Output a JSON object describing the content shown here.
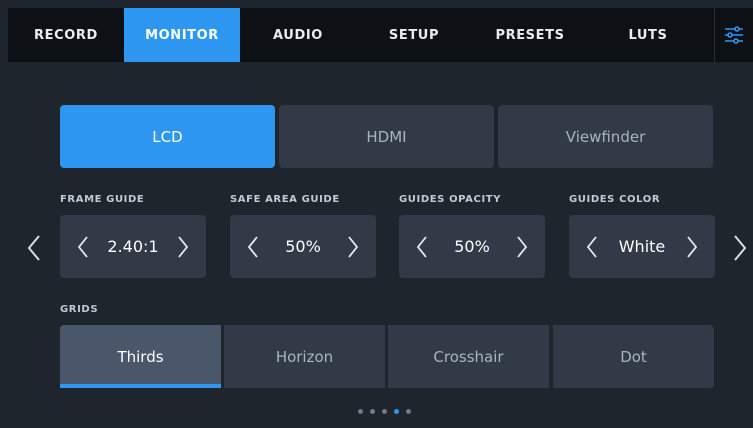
{
  "tabs": [
    {
      "label": "RECORD",
      "active": false
    },
    {
      "label": "MONITOR",
      "active": true
    },
    {
      "label": "AUDIO",
      "active": false
    },
    {
      "label": "SETUP",
      "active": false
    },
    {
      "label": "PRESETS",
      "active": false
    },
    {
      "label": "LUTS",
      "active": false
    }
  ],
  "settings_icon": "sliders-icon",
  "outputs": [
    {
      "label": "LCD",
      "active": true
    },
    {
      "label": "HDMI",
      "active": false
    },
    {
      "label": "Viewfinder",
      "active": false
    }
  ],
  "controls": [
    {
      "label": "FRAME GUIDE",
      "value": "2.40:1"
    },
    {
      "label": "SAFE AREA GUIDE",
      "value": "50%"
    },
    {
      "label": "GUIDES OPACITY",
      "value": "50%"
    },
    {
      "label": "GUIDES COLOR",
      "value": "White"
    }
  ],
  "grids": {
    "label": "GRIDS",
    "options": [
      {
        "label": "Thirds",
        "active": true
      },
      {
        "label": "Horizon",
        "active": false
      },
      {
        "label": "Crosshair",
        "active": false
      },
      {
        "label": "Dot",
        "active": false
      }
    ]
  },
  "pagination": {
    "total": 5,
    "current": 4
  },
  "colors": {
    "accent": "#2d97f2",
    "background": "#1f252d",
    "tabbar": "#0d1116",
    "button": "#313a46"
  }
}
